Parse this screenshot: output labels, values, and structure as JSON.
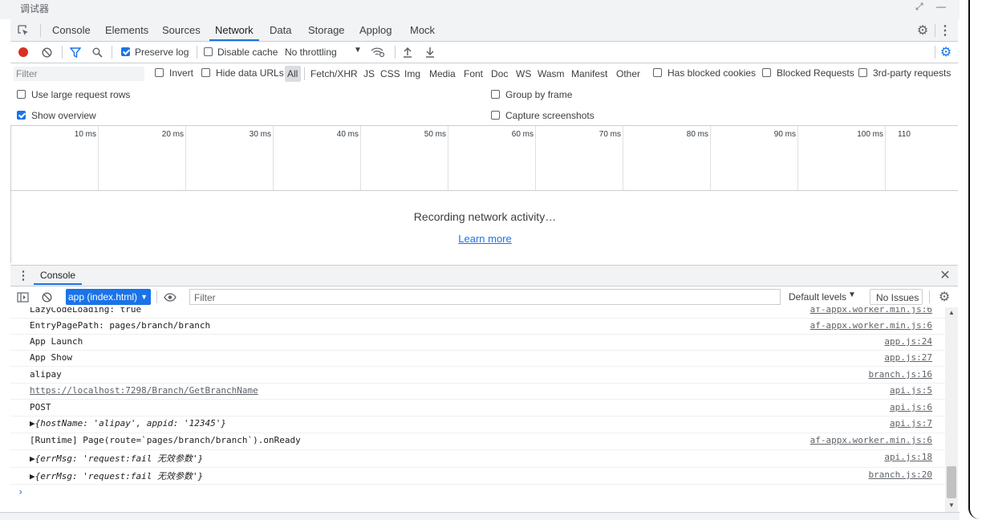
{
  "window": {
    "title": "调试器"
  },
  "tabs": [
    "Console",
    "Elements",
    "Sources",
    "Network",
    "Data",
    "Storage",
    "Applog",
    "Mock"
  ],
  "active_tab": "Network",
  "toolbar": {
    "preserve_log": "Preserve log",
    "disable_cache": "Disable cache",
    "throttling": "No throttling"
  },
  "filterbar": {
    "filter_placeholder": "Filter",
    "invert": "Invert",
    "hide_data_urls": "Hide data URLs",
    "types": [
      "All",
      "Fetch/XHR",
      "JS",
      "CSS",
      "Img",
      "Media",
      "Font",
      "Doc",
      "WS",
      "Wasm",
      "Manifest",
      "Other"
    ],
    "has_blocked_cookies": "Has blocked cookies",
    "blocked_requests": "Blocked Requests",
    "third_party": "3rd-party requests"
  },
  "options": {
    "large_rows": "Use large request rows",
    "group_by_frame": "Group by frame",
    "show_overview": "Show overview",
    "capture_screenshots": "Capture screenshots"
  },
  "overview": {
    "ticks": [
      "10 ms",
      "20 ms",
      "30 ms",
      "40 ms",
      "50 ms",
      "60 ms",
      "70 ms",
      "80 ms",
      "90 ms",
      "100 ms",
      "110"
    ]
  },
  "recording": {
    "text": "Recording network activity…",
    "learn_more": "Learn more"
  },
  "drawer": {
    "tab": "Console"
  },
  "console_toolbar": {
    "context": "app (index.html)",
    "filter_placeholder": "Filter",
    "levels": "Default levels",
    "issues": "No Issues"
  },
  "logs": [
    {
      "msg": "  LazyCodeLoading: true",
      "src": "af-appx.worker.min.js:6"
    },
    {
      "msg": "  EntryPagePath: pages/branch/branch",
      "src": "af-appx.worker.min.js:6"
    },
    {
      "msg": "App Launch",
      "src": "app.js:24"
    },
    {
      "msg": "App Show",
      "src": "app.js:27"
    },
    {
      "msg": " alipay",
      "src": "branch.js:16"
    },
    {
      "msg": " https://localhost:7298/Branch/GetBranchName",
      "src": "api.js:5"
    },
    {
      "msg": "POST",
      "src": "api.js:6"
    },
    {
      "msg": "▶{hostName: 'alipay', appid: '12345'}",
      "src": "api.js:7"
    },
    {
      "msg": "[Runtime] Page(route=`pages/branch/branch`).onReady",
      "src": "af-appx.worker.min.js:6"
    },
    {
      "msg": "▶{errMsg: 'request:fail 无效参数'}",
      "src": "api.js:18"
    },
    {
      "msg": "▶{errMsg: 'request:fail 无效参数'}",
      "src": "branch.js:20"
    }
  ],
  "colors": {
    "accent": "#1a73e8",
    "record": "#d93025",
    "string": "#c41a16"
  }
}
